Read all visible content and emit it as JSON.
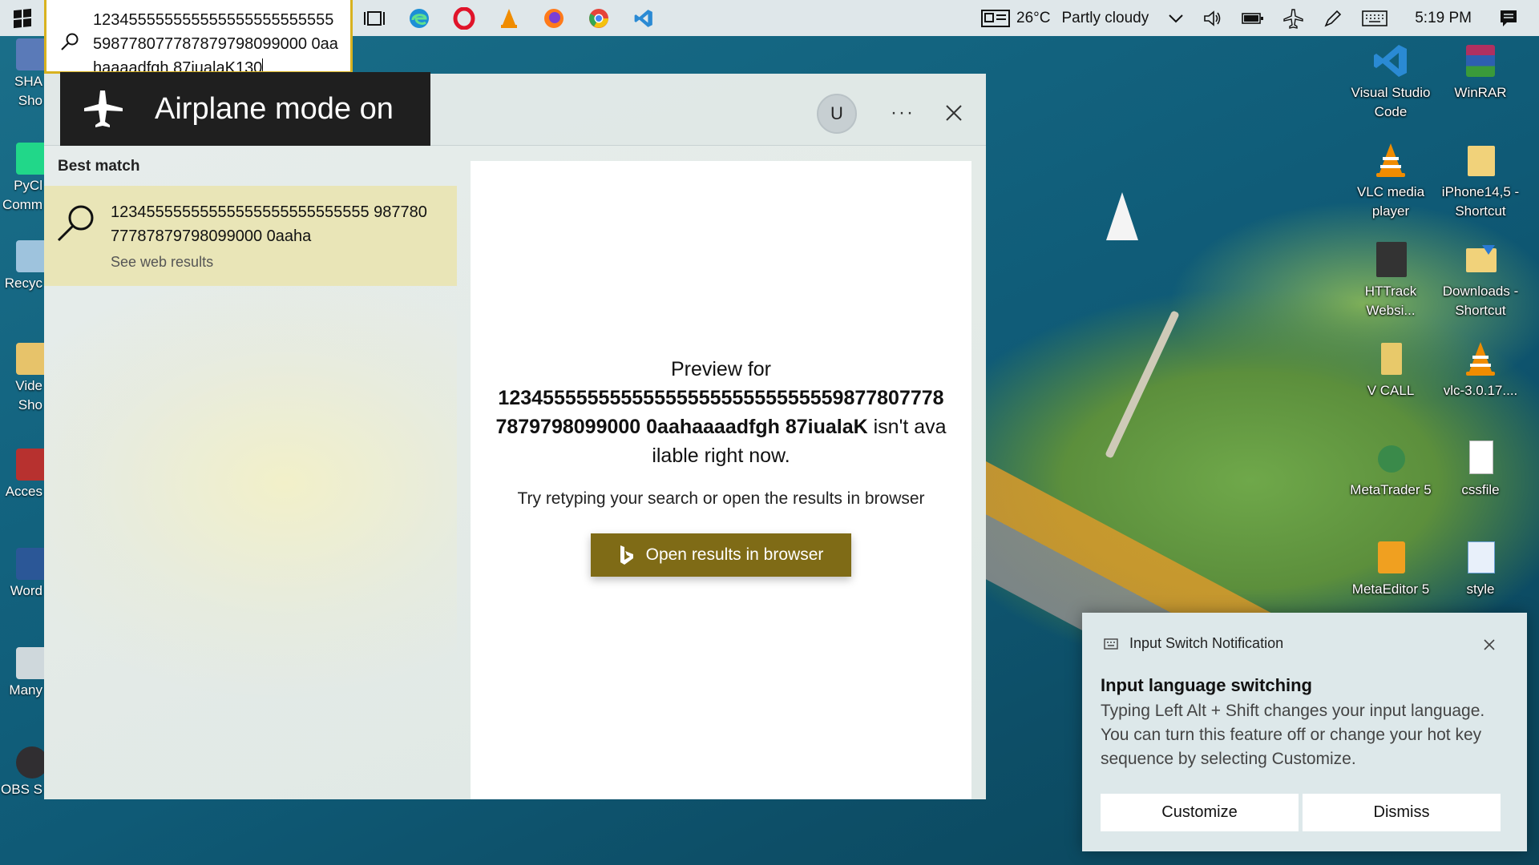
{
  "taskbar": {
    "pinned_icons": [
      "task-view-icon",
      "edge-icon",
      "opera-icon",
      "vlc-icon",
      "firefox-icon",
      "chrome-icon",
      "vscode-icon"
    ],
    "weather": {
      "temp": "26°C",
      "condition": "Partly cloudy",
      "icon": "news-weather-icon"
    },
    "time": "5:19 PM",
    "colors": {
      "bar": "#dfe7ea"
    }
  },
  "search": {
    "query": "123455555555555555555555555598778077787879798099000 0aahaaaadfgh 87iualaK130",
    "focus_color": "#d8b21f"
  },
  "airplane_osd": {
    "text": "Airplane mode on"
  },
  "panel": {
    "avatar_initial": "U",
    "more_label": "···",
    "best_match_label": "Best match",
    "result": {
      "text": "12345555555555555555555555555 98778077787879798099000 0aaha",
      "sub": "See web results",
      "highlight": "#e9e5b7"
    },
    "preview": {
      "title_prefix": "Preview for",
      "title_query": "12345555555555555555555555555598778077787879798099000 0aahaaaadfgh 87iualaK",
      "title_suffix": "isn't available right now.",
      "hint": "Try retyping your search or open the results in browser",
      "button_label": "Open results in browser",
      "button_color": "#7f6b16"
    }
  },
  "desktop_icons_right": [
    {
      "label": "Visual Studio Code",
      "icon": "vscode-icon"
    },
    {
      "label": "WinRAR",
      "icon": "winrar-icon"
    },
    {
      "label": "VLC media player",
      "icon": "vlc-icon"
    },
    {
      "label": "iPhone14,5 - Shortcut",
      "icon": "folder-shortcut-icon"
    },
    {
      "label": "HTTrack Websi...",
      "icon": "httrack-icon"
    },
    {
      "label": "Downloads - Shortcut",
      "icon": "downloads-folder-icon"
    },
    {
      "label": "V CALL",
      "icon": "vcall-icon"
    },
    {
      "label": "vlc-3.0.17....",
      "icon": "vlc-installer-icon"
    },
    {
      "label": "MetaTrader 5",
      "icon": "metatrader-icon"
    },
    {
      "label": "cssfile",
      "icon": "text-file-icon"
    },
    {
      "label": "MetaEditor 5",
      "icon": "metaeditor-icon"
    },
    {
      "label": "style",
      "icon": "style-file-icon"
    }
  ],
  "desktop_icons_left": [
    {
      "label": "SHA",
      "label2": "Sho"
    },
    {
      "label": "PyCl",
      "label2": "Comm"
    },
    {
      "label": "Recyc",
      "label2": ""
    },
    {
      "label": "Vide",
      "label2": "Sho"
    },
    {
      "label": "Acces",
      "label2": ""
    },
    {
      "label": "Word",
      "label2": ""
    },
    {
      "label": "Many",
      "label2": ""
    },
    {
      "label": "OBS S",
      "label2": ""
    }
  ],
  "toast": {
    "app": "Input Switch Notification",
    "title": "Input language switching",
    "body": "Typing Left Alt + Shift changes your input language. You can turn this feature off or change your hot key sequence by selecting Customize.",
    "customize_label": "Customize",
    "dismiss_label": "Dismiss"
  }
}
